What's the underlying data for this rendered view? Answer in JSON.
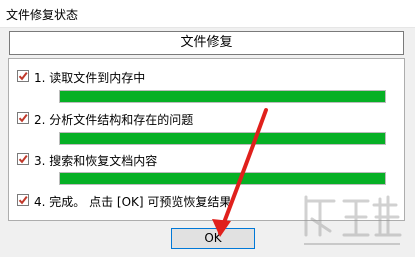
{
  "window": {
    "title": "文件修复状态"
  },
  "header": {
    "title": "文件修复"
  },
  "steps": [
    {
      "label": "1. 读取文件到内存中",
      "checked": true,
      "progress": 1.0
    },
    {
      "label": "2. 分析文件结构和存在的问题",
      "checked": true,
      "progress": 1.0
    },
    {
      "label": "3. 搜索和恢复文档内容",
      "checked": true,
      "progress": 1.0
    },
    {
      "label": "4. 完成。 点击 [OK] 可预览恢复结果",
      "checked": true
    }
  ],
  "buttons": {
    "ok_label": "OK"
  },
  "colors": {
    "progress_fill": "#06b025",
    "check_mark": "#c0392b",
    "annotation_arrow": "#e0201c"
  }
}
